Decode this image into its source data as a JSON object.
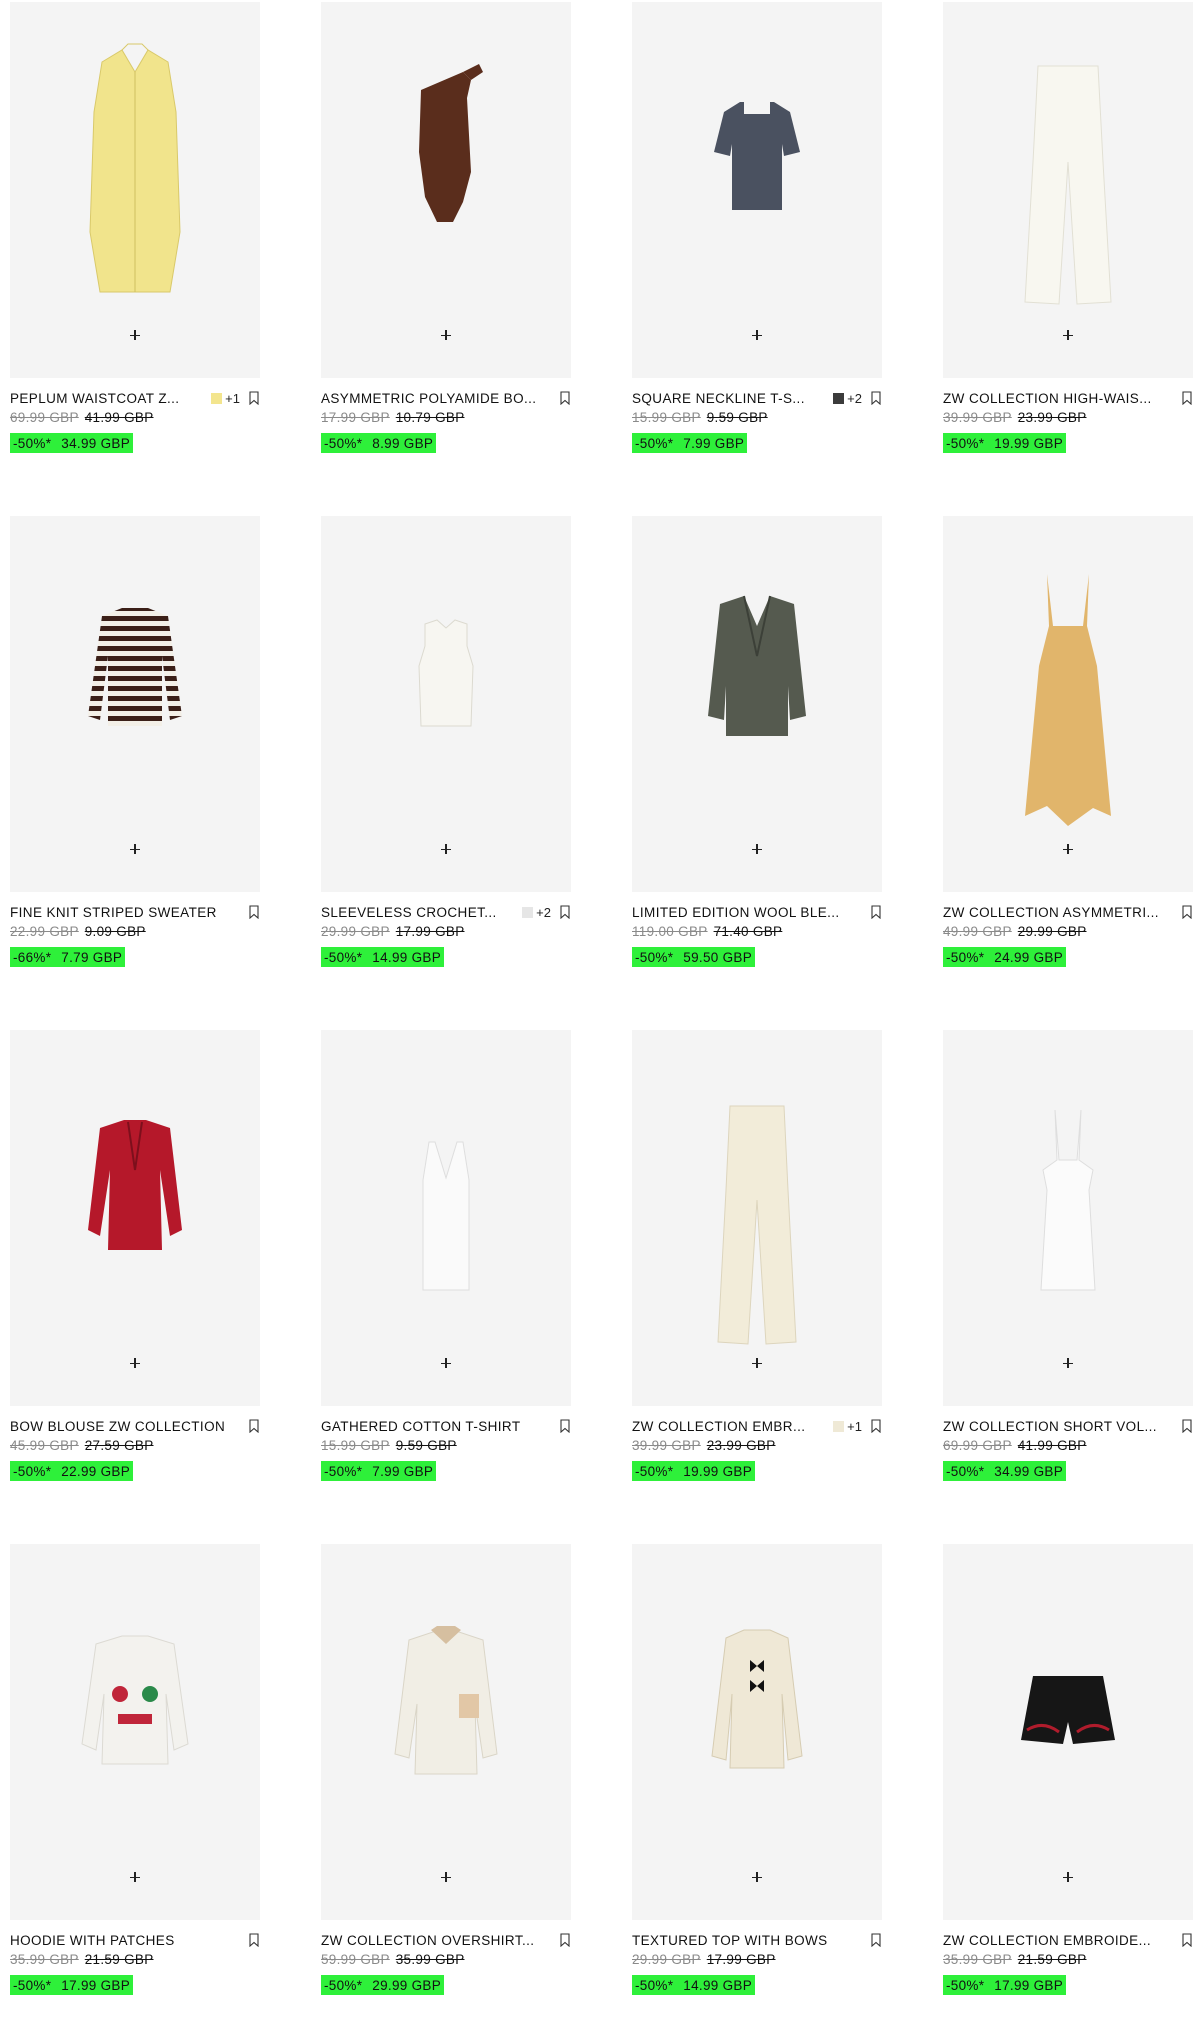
{
  "accent": {
    "sale_bg": "#2ef03a",
    "placeholder_bg": "#f4f4f4"
  },
  "add_label": "+",
  "products": [
    {
      "name": "PEPLUM WAISTCOAT Z...",
      "swatch": "#f3e58e",
      "more": "+1",
      "original_price": "69.99 GBP",
      "previous_price": "41.99 GBP",
      "discount": "-50%*",
      "sale_price": "34.99 GBP"
    },
    {
      "name": "ASYMMETRIC POLYAMIDE BO...",
      "swatch": null,
      "more": "",
      "original_price": "17.99 GBP",
      "previous_price": "10.79 GBP",
      "discount": "-50%*",
      "sale_price": "8.99 GBP"
    },
    {
      "name": "SQUARE NECKLINE T-S...",
      "swatch": "#3b3b3b",
      "more": "+2",
      "original_price": "15.99 GBP",
      "previous_price": "9.59 GBP",
      "discount": "-50%*",
      "sale_price": "7.99 GBP"
    },
    {
      "name": "ZW COLLECTION HIGH-WAIS...",
      "swatch": null,
      "more": "",
      "original_price": "39.99 GBP",
      "previous_price": "23.99 GBP",
      "discount": "-50%*",
      "sale_price": "19.99 GBP"
    },
    {
      "name": "FINE KNIT STRIPED SWEATER",
      "swatch": null,
      "more": "",
      "original_price": "22.99 GBP",
      "previous_price": "9.09 GBP",
      "discount": "-66%*",
      "sale_price": "7.79 GBP"
    },
    {
      "name": "SLEEVELESS CROCHET...",
      "swatch": "#e6e6e6",
      "more": "+2",
      "original_price": "29.99 GBP",
      "previous_price": "17.99 GBP",
      "discount": "-50%*",
      "sale_price": "14.99 GBP"
    },
    {
      "name": "LIMITED EDITION WOOL BLE...",
      "swatch": null,
      "more": "",
      "original_price": "119.00 GBP",
      "previous_price": "71.40 GBP",
      "discount": "-50%*",
      "sale_price": "59.50 GBP"
    },
    {
      "name": "ZW COLLECTION ASYMMETRI...",
      "swatch": null,
      "more": "",
      "original_price": "49.99 GBP",
      "previous_price": "29.99 GBP",
      "discount": "-50%*",
      "sale_price": "24.99 GBP"
    },
    {
      "name": "BOW BLOUSE ZW COLLECTION",
      "swatch": null,
      "more": "",
      "original_price": "45.99 GBP",
      "previous_price": "27.59 GBP",
      "discount": "-50%*",
      "sale_price": "22.99 GBP"
    },
    {
      "name": "GATHERED COTTON T-SHIRT",
      "swatch": null,
      "more": "",
      "original_price": "15.99 GBP",
      "previous_price": "9.59 GBP",
      "discount": "-50%*",
      "sale_price": "7.99 GBP"
    },
    {
      "name": "ZW COLLECTION EMBR...",
      "swatch": "#efe9d6",
      "more": "+1",
      "original_price": "39.99 GBP",
      "previous_price": "23.99 GBP",
      "discount": "-50%*",
      "sale_price": "19.99 GBP"
    },
    {
      "name": "ZW COLLECTION SHORT VOL...",
      "swatch": null,
      "more": "",
      "original_price": "69.99 GBP",
      "previous_price": "41.99 GBP",
      "discount": "-50%*",
      "sale_price": "34.99 GBP"
    },
    {
      "name": "HOODIE WITH PATCHES",
      "swatch": null,
      "more": "",
      "original_price": "35.99 GBP",
      "previous_price": "21.59 GBP",
      "discount": "-50%*",
      "sale_price": "17.99 GBP"
    },
    {
      "name": "ZW COLLECTION OVERSHIRT...",
      "swatch": null,
      "more": "",
      "original_price": "59.99 GBP",
      "previous_price": "35.99 GBP",
      "discount": "-50%*",
      "sale_price": "29.99 GBP"
    },
    {
      "name": "TEXTURED TOP WITH BOWS",
      "swatch": null,
      "more": "",
      "original_price": "29.99 GBP",
      "previous_price": "17.99 GBP",
      "discount": "-50%*",
      "sale_price": "14.99 GBP"
    },
    {
      "name": "ZW COLLECTION EMBROIDE...",
      "swatch": null,
      "more": "",
      "original_price": "35.99 GBP",
      "previous_price": "21.59 GBP",
      "discount": "-50%*",
      "sale_price": "17.99 GBP"
    }
  ]
}
